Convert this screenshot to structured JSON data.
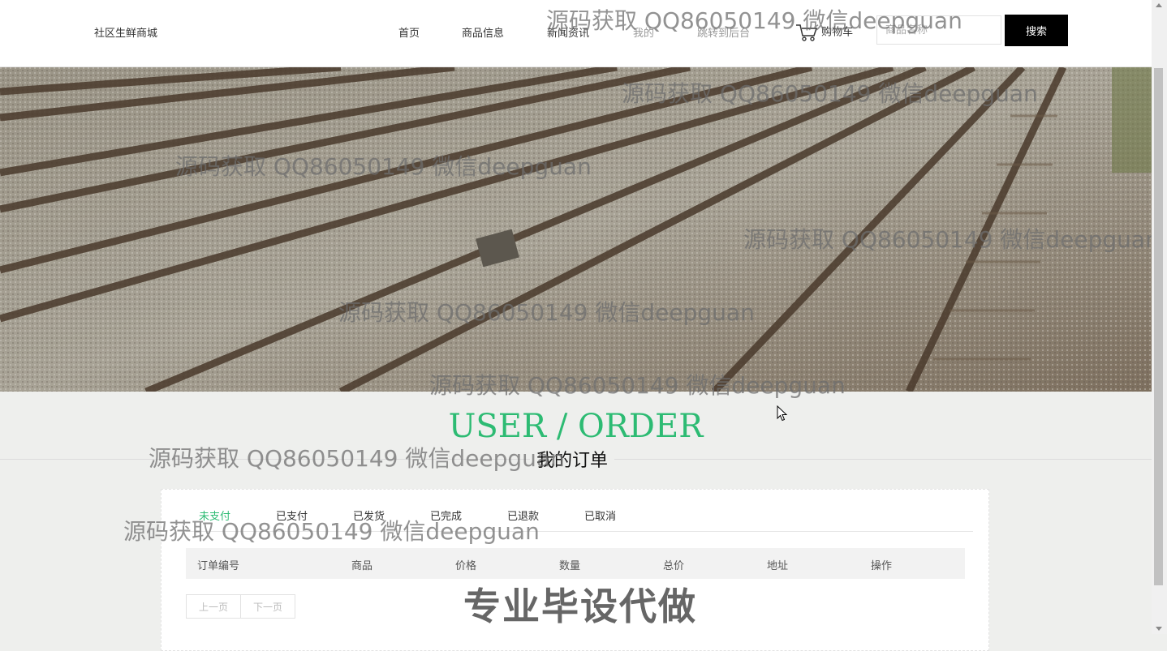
{
  "header": {
    "brand": "社区生鲜商城",
    "nav": [
      {
        "label": "首页"
      },
      {
        "label": "商品信息"
      },
      {
        "label": "新闻资讯"
      },
      {
        "label": "我的"
      },
      {
        "label": "跳转到后台"
      }
    ],
    "cart_label": "购物车",
    "search_placeholder": "商品名称",
    "search_button": "搜索"
  },
  "section": {
    "title": "USER / ORDER",
    "subtitle": "我的订单"
  },
  "orders": {
    "tabs": [
      {
        "label": "未支付",
        "active": true
      },
      {
        "label": "已支付"
      },
      {
        "label": "已发货"
      },
      {
        "label": "已完成"
      },
      {
        "label": "已退款"
      },
      {
        "label": "已取消"
      }
    ],
    "columns": [
      "订单编号",
      "商品",
      "价格",
      "数量",
      "总价",
      "地址",
      "操作"
    ],
    "prev_label": "上一页",
    "next_label": "下一页"
  },
  "watermarks": {
    "text": "源码获取 QQ86050149 微信deepguan",
    "big_text": "专业毕设代做"
  },
  "colors": {
    "accent": "#2dbb73",
    "button_bg": "#000000"
  }
}
